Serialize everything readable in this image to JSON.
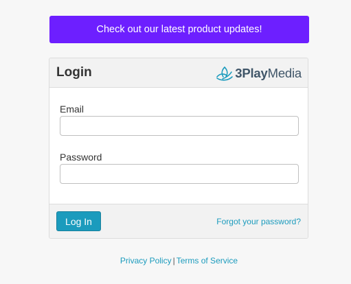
{
  "banner": {
    "text": "Check out our latest product updates!"
  },
  "login_card": {
    "title": "Login",
    "brand": {
      "name_part1": "3Play",
      "name_part2": "Media",
      "icon": "3play-logo-icon",
      "color": "#3f5568",
      "icon_color": "#1b9bbd"
    },
    "email": {
      "label": "Email",
      "value": "",
      "placeholder": ""
    },
    "password": {
      "label": "Password",
      "value": "",
      "placeholder": ""
    },
    "login_button": "Log In",
    "forgot_password": "Forgot your password?"
  },
  "footer_links": {
    "privacy": "Privacy Policy",
    "separator": "|",
    "terms": "Terms of Service"
  },
  "colors": {
    "banner_bg": "#6d1fff",
    "accent": "#1b9bbd",
    "page_bg": "#f7f7f7"
  }
}
